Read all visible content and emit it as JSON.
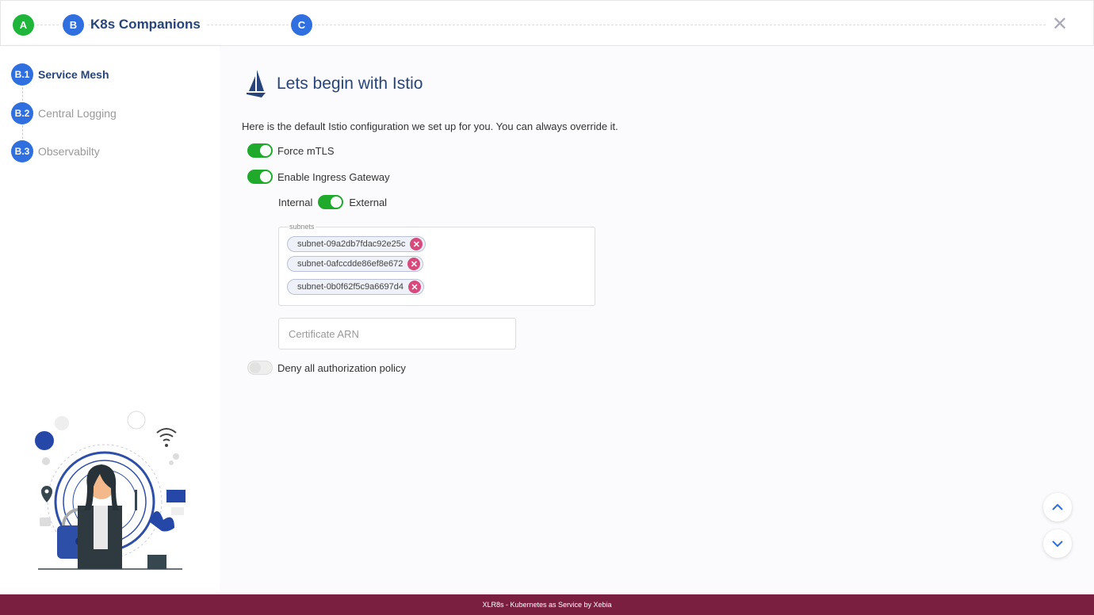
{
  "stepper": {
    "steps": [
      {
        "badge": "A"
      },
      {
        "badge": "B",
        "label": "K8s Companions"
      },
      {
        "badge": "C"
      }
    ],
    "close_icon": "close-icon"
  },
  "sidebar": {
    "items": [
      {
        "badge": "B.1",
        "label": "Service Mesh",
        "active": true
      },
      {
        "badge": "B.2",
        "label": "Central Logging",
        "active": false
      },
      {
        "badge": "B.3",
        "label": "Observabilty",
        "active": false
      }
    ]
  },
  "main": {
    "title": "Lets begin with Istio",
    "title_icon": "istio-sail-icon",
    "description": "Here is the default Istio configuration we set up for you. You can always override it.",
    "force_mtls": {
      "label": "Force mTLS",
      "on": true
    },
    "ingress": {
      "label": "Enable Ingress Gateway",
      "on": true
    },
    "gateway_type": {
      "left": "Internal",
      "right": "External",
      "selected": "External"
    },
    "subnets": {
      "legend": "subnets",
      "chips": [
        "subnet-09a2db7fdac92e25c",
        "subnet-0afccdde86ef8e672",
        "subnet-0b0f62f5c9a6697d4"
      ]
    },
    "certificate": {
      "placeholder": "Certificate ARN",
      "value": ""
    },
    "deny_policy": {
      "label": "Deny all authorization policy",
      "on": false
    }
  },
  "footer": {
    "text": "XLR8s - Kubernetes as Service by Xebia"
  },
  "colors": {
    "primary": "#2f6fe0",
    "success": "#1fb53a",
    "footer": "#7a1f3f",
    "chip_remove": "#d84a7c"
  }
}
